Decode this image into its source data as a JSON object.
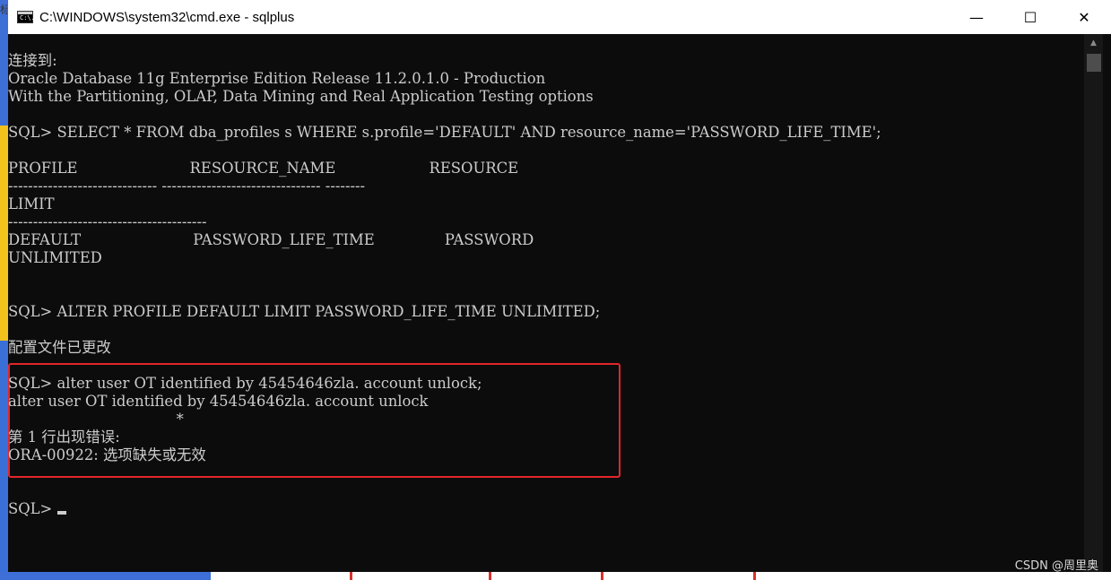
{
  "window": {
    "title": "C:\\WINDOWS\\system32\\cmd.exe - sqlplus",
    "icon_text": "C:\\.",
    "controls": {
      "minimize": "—",
      "maximize": "☐",
      "close": "✕"
    }
  },
  "console": {
    "lines": [
      "连接到:",
      "Oracle Database 11g Enterprise Edition Release 11.2.0.1.0 - Production",
      "With the Partitioning, OLAP, Data Mining and Real Application Testing options",
      "",
      "SQL> SELECT * FROM dba_profiles s WHERE s.profile='DEFAULT' AND resource_name='PASSWORD_LIFE_TIME';",
      "",
      "PROFILE                        RESOURCE_NAME                    RESOURCE",
      "------------------------------ -------------------------------- --------",
      "LIMIT",
      "----------------------------------------",
      "DEFAULT                        PASSWORD_LIFE_TIME               PASSWORD",
      "UNLIMITED",
      "",
      "",
      "SQL> ALTER PROFILE DEFAULT LIMIT PASSWORD_LIFE_TIME UNLIMITED;",
      "",
      "配置文件已更改",
      "",
      "SQL> alter user OT identified by 45454646zla. account unlock;",
      "alter user OT identified by 45454646zla. account unlock",
      "                                    *",
      "第 1 行出现错误:",
      "ORA-00922: 选项缺失或无效",
      "",
      "",
      "SQL> "
    ]
  },
  "watermark": "CSDN @周里奥"
}
